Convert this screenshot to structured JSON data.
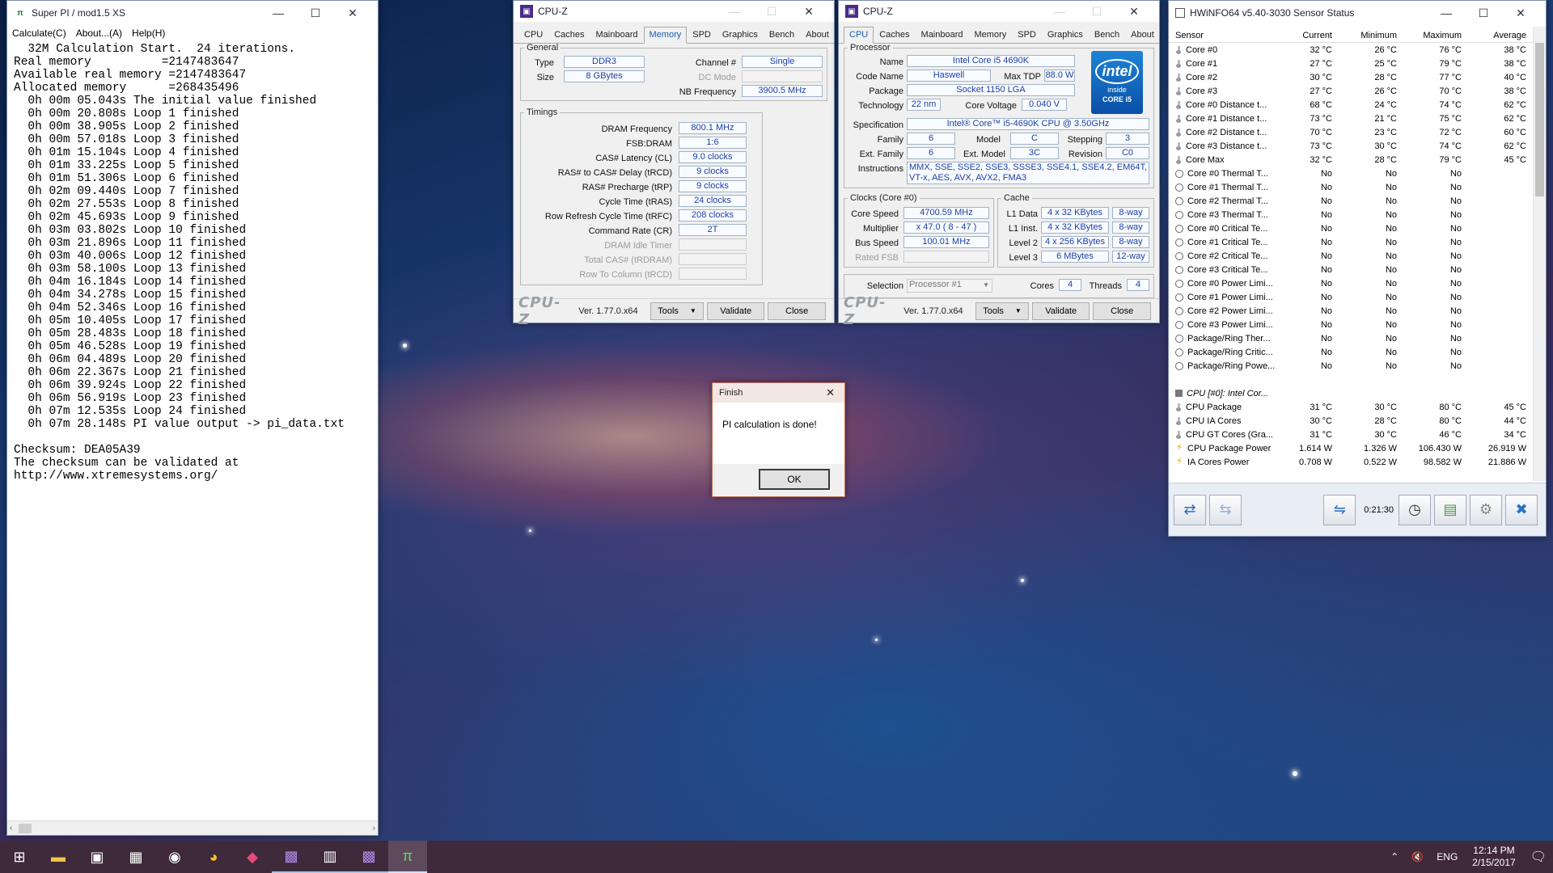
{
  "superpi": {
    "title": "Super PI / mod1.5 XS",
    "menu": [
      "Calculate(C)",
      "About...(A)",
      "Help(H)"
    ],
    "lines": [
      "  32M Calculation Start.  24 iterations.",
      "Real memory          =2147483647",
      "Available real memory =2147483647",
      "Allocated memory      =268435496",
      "  0h 00m 05.043s The initial value finished",
      "  0h 00m 20.808s Loop 1 finished",
      "  0h 00m 38.905s Loop 2 finished",
      "  0h 00m 57.018s Loop 3 finished",
      "  0h 01m 15.104s Loop 4 finished",
      "  0h 01m 33.225s Loop 5 finished",
      "  0h 01m 51.306s Loop 6 finished",
      "  0h 02m 09.440s Loop 7 finished",
      "  0h 02m 27.553s Loop 8 finished",
      "  0h 02m 45.693s Loop 9 finished",
      "  0h 03m 03.802s Loop 10 finished",
      "  0h 03m 21.896s Loop 11 finished",
      "  0h 03m 40.006s Loop 12 finished",
      "  0h 03m 58.100s Loop 13 finished",
      "  0h 04m 16.184s Loop 14 finished",
      "  0h 04m 34.278s Loop 15 finished",
      "  0h 04m 52.346s Loop 16 finished",
      "  0h 05m 10.405s Loop 17 finished",
      "  0h 05m 28.483s Loop 18 finished",
      "  0h 05m 46.528s Loop 19 finished",
      "  0h 06m 04.489s Loop 20 finished",
      "  0h 06m 22.367s Loop 21 finished",
      "  0h 06m 39.924s Loop 22 finished",
      "  0h 06m 56.919s Loop 23 finished",
      "  0h 07m 12.535s Loop 24 finished",
      "  0h 07m 28.148s PI value output -> pi_data.txt",
      "",
      "Checksum: DEA05A39",
      "The checksum can be validated at",
      "http://www.xtremesystems.org/"
    ]
  },
  "cpuz_common": {
    "title": "CPU-Z",
    "tabs": [
      "CPU",
      "Caches",
      "Mainboard",
      "Memory",
      "SPD",
      "Graphics",
      "Bench",
      "About"
    ],
    "logo": "CPU-Z",
    "version": "Ver. 1.77.0.x64",
    "tools": "Tools",
    "validate": "Validate",
    "close": "Close"
  },
  "mem": {
    "general_legend": "General",
    "type_label": "Type",
    "type": "DDR3",
    "size_label": "Size",
    "size": "8 GBytes",
    "channel_label": "Channel #",
    "channel": "Single",
    "dc_label": "DC Mode",
    "nb_label": "NB Frequency",
    "nb": "3900.5 MHz",
    "timings_legend": "Timings",
    "timings": [
      [
        "DRAM Frequency",
        "800.1 MHz"
      ],
      [
        "FSB:DRAM",
        "1:6"
      ],
      [
        "CAS# Latency (CL)",
        "9.0 clocks"
      ],
      [
        "RAS# to CAS# Delay (tRCD)",
        "9 clocks"
      ],
      [
        "RAS# Precharge (tRP)",
        "9 clocks"
      ],
      [
        "Cycle Time (tRAS)",
        "24 clocks"
      ],
      [
        "Row Refresh Cycle Time (tRFC)",
        "208 clocks"
      ],
      [
        "Command Rate (CR)",
        "2T"
      ],
      [
        "DRAM Idle Timer",
        ""
      ],
      [
        "Total CAS# (tRDRAM)",
        ""
      ],
      [
        "Row To Column (tRCD)",
        ""
      ]
    ]
  },
  "cpu": {
    "proc_legend": "Processor",
    "name_label": "Name",
    "name": "Intel Core i5 4690K",
    "code_label": "Code Name",
    "code": "Haswell",
    "tdp_label": "Max TDP",
    "tdp": "88.0 W",
    "pkg_label": "Package",
    "pkg": "Socket 1150 LGA",
    "tech_label": "Technology",
    "tech": "22 nm",
    "volt_label": "Core Voltage",
    "volt": "0.040 V",
    "spec_label": "Specification",
    "spec": "Intel® Core™ i5-4690K CPU @ 3.50GHz",
    "fam_label": "Family",
    "fam": "6",
    "model_label": "Model",
    "model": "C",
    "step_label": "Stepping",
    "step": "3",
    "efam_label": "Ext. Family",
    "efam": "6",
    "emodel_label": "Ext. Model",
    "emodel": "3C",
    "rev_label": "Revision",
    "rev": "C0",
    "instr_label": "Instructions",
    "instr": "MMX, SSE, SSE2, SSE3, SSSE3, SSE4.1, SSE4.2, EM64T, VT-x, AES, AVX, AVX2, FMA3",
    "intel_logo": "intel",
    "intel_inside": "inside",
    "intel_core": "CORE i5",
    "clocks_legend": "Clocks (Core #0)",
    "cs_label": "Core Speed",
    "cs": "4700.59 MHz",
    "mult_label": "Multiplier",
    "mult": "x 47.0 ( 8 - 47 )",
    "bus_label": "Bus Speed",
    "bus": "100.01 MHz",
    "fsb_label": "Rated FSB",
    "cache_legend": "Cache",
    "l1d_label": "L1 Data",
    "l1d": "4 x 32 KBytes",
    "l1d_w": "8-way",
    "l1i_label": "L1 Inst.",
    "l1i": "4 x 32 KBytes",
    "l1i_w": "8-way",
    "l2_label": "Level 2",
    "l2": "4 x 256 KBytes",
    "l2_w": "8-way",
    "l3_label": "Level 3",
    "l3": "6 MBytes",
    "l3_w": "12-way",
    "sel_label": "Selection",
    "sel": "Processor #1",
    "cores_label": "Cores",
    "cores": "4",
    "threads_label": "Threads",
    "threads": "4"
  },
  "finish": {
    "title": "Finish",
    "message": "PI calculation is done!",
    "ok": "OK"
  },
  "hwinfo": {
    "title": "HWiNFO64 v5.40-3030 Sensor Status",
    "headers": [
      "Sensor",
      "Current",
      "Minimum",
      "Maximum",
      "Average"
    ],
    "rows": [
      [
        "therm",
        "Core #0",
        "32 °C",
        "26 °C",
        "76 °C",
        "38 °C"
      ],
      [
        "therm",
        "Core #1",
        "27 °C",
        "25 °C",
        "79 °C",
        "38 °C"
      ],
      [
        "therm",
        "Core #2",
        "30 °C",
        "28 °C",
        "77 °C",
        "40 °C"
      ],
      [
        "therm",
        "Core #3",
        "27 °C",
        "26 °C",
        "70 °C",
        "38 °C"
      ],
      [
        "therm",
        "Core #0 Distance t...",
        "68 °C",
        "24 °C",
        "74 °C",
        "62 °C"
      ],
      [
        "therm",
        "Core #1 Distance t...",
        "73 °C",
        "21 °C",
        "75 °C",
        "62 °C"
      ],
      [
        "therm",
        "Core #2 Distance t...",
        "70 °C",
        "23 °C",
        "72 °C",
        "60 °C"
      ],
      [
        "therm",
        "Core #3 Distance t...",
        "73 °C",
        "30 °C",
        "74 °C",
        "62 °C"
      ],
      [
        "therm",
        "Core Max",
        "32 °C",
        "28 °C",
        "79 °C",
        "45 °C"
      ],
      [
        "circ",
        "Core #0 Thermal T...",
        "No",
        "No",
        "No",
        ""
      ],
      [
        "circ",
        "Core #1 Thermal T...",
        "No",
        "No",
        "No",
        ""
      ],
      [
        "circ",
        "Core #2 Thermal T...",
        "No",
        "No",
        "No",
        ""
      ],
      [
        "circ",
        "Core #3 Thermal T...",
        "No",
        "No",
        "No",
        ""
      ],
      [
        "circ",
        "Core #0 Critical Te...",
        "No",
        "No",
        "No",
        ""
      ],
      [
        "circ",
        "Core #1 Critical Te...",
        "No",
        "No",
        "No",
        ""
      ],
      [
        "circ",
        "Core #2 Critical Te...",
        "No",
        "No",
        "No",
        ""
      ],
      [
        "circ",
        "Core #3 Critical Te...",
        "No",
        "No",
        "No",
        ""
      ],
      [
        "circ",
        "Core #0 Power Limi...",
        "No",
        "No",
        "No",
        ""
      ],
      [
        "circ",
        "Core #1 Power Limi...",
        "No",
        "No",
        "No",
        ""
      ],
      [
        "circ",
        "Core #2 Power Limi...",
        "No",
        "No",
        "No",
        ""
      ],
      [
        "circ",
        "Core #3 Power Limi...",
        "No",
        "No",
        "No",
        ""
      ],
      [
        "circ",
        "Package/Ring Ther...",
        "No",
        "No",
        "No",
        ""
      ],
      [
        "circ",
        "Package/Ring Critic...",
        "No",
        "No",
        "No",
        ""
      ],
      [
        "circ",
        "Package/Ring Powe...",
        "No",
        "No",
        "No",
        ""
      ],
      [
        "blank",
        "",
        "",
        "",
        "",
        ""
      ],
      [
        "chip",
        "CPU [#0]: Intel Cor...",
        "",
        "",
        "",
        ""
      ],
      [
        "therm",
        "CPU Package",
        "31 °C",
        "30 °C",
        "80 °C",
        "45 °C"
      ],
      [
        "therm",
        "CPU IA Cores",
        "30 °C",
        "28 °C",
        "80 °C",
        "44 °C"
      ],
      [
        "therm",
        "CPU GT Cores (Gra...",
        "31 °C",
        "30 °C",
        "46 °C",
        "34 °C"
      ],
      [
        "bolt",
        "CPU Package Power",
        "1.614 W",
        "1.326 W",
        "106.430 W",
        "26.919 W"
      ],
      [
        "bolt",
        "IA Cores Power",
        "0.708 W",
        "0.522 W",
        "98.582 W",
        "21.886 W"
      ]
    ],
    "timer": "0:21:30"
  },
  "taskbar": {
    "lang": "ENG",
    "time": "12:14 PM",
    "date": "2/15/2017"
  }
}
